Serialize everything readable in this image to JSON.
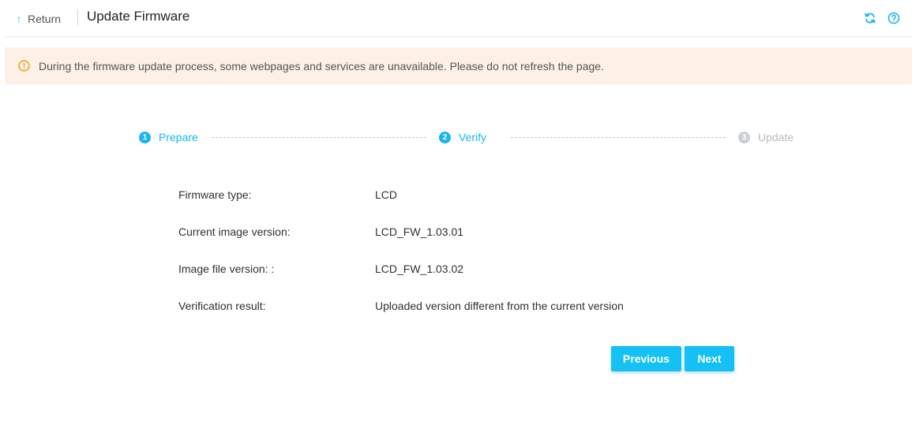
{
  "header": {
    "return_label": "Return",
    "title": "Update Firmware",
    "icons": [
      "refresh-icon",
      "help-icon"
    ]
  },
  "warning": {
    "icon": "warning-icon",
    "text": "During the firmware update process, some webpages and services are unavailable. Please do not refresh the page."
  },
  "steps": [
    {
      "number": "1",
      "label": "Prepare",
      "state": "done"
    },
    {
      "number": "2",
      "label": "Verify",
      "state": "active"
    },
    {
      "number": "3",
      "label": "Update",
      "state": "pending"
    }
  ],
  "info": [
    {
      "label": "Firmware type:",
      "value": "LCD"
    },
    {
      "label": "Current image version:",
      "value": "LCD_FW_1.03.01"
    },
    {
      "label": "Image file version: :",
      "value": "LCD_FW_1.03.02"
    },
    {
      "label": "Verification result:",
      "value": "Uploaded version different from the current version"
    }
  ],
  "buttons": {
    "previous": "Previous",
    "next": "Next"
  },
  "colors": {
    "accent": "#1ab5f0",
    "button": "#15c0f5",
    "warning_bg": "#fdf0e7",
    "warning_icon": "#f0a020",
    "pending": "#c9cdd4"
  }
}
